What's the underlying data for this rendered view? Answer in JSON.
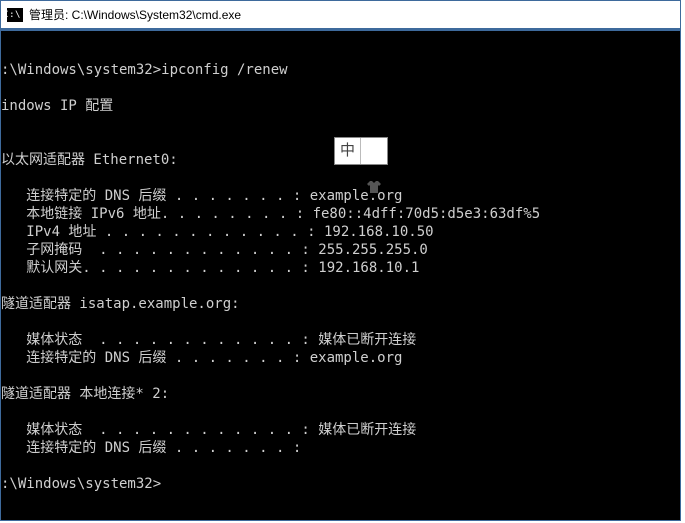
{
  "window": {
    "icon_text": "C:\\.",
    "title": "管理员: C:\\Windows\\System32\\cmd.exe"
  },
  "ime": {
    "mode": "中",
    "icon": "tshirt-icon"
  },
  "terminal": {
    "line01": ":\\Windows\\system32>ipconfig /renew",
    "line02": "",
    "line03": "indows IP 配置",
    "line04": "",
    "line05": "",
    "line06": "以太网适配器 Ethernet0:",
    "line07": "",
    "line08": "   连接特定的 DNS 后缀 . . . . . . . : example.org",
    "line09": "   本地链接 IPv6 地址. . . . . . . . : fe80::4dff:70d5:d5e3:63df%5",
    "line10": "   IPv4 地址 . . . . . . . . . . . . : 192.168.10.50",
    "line11": "   子网掩码  . . . . . . . . . . . . : 255.255.255.0",
    "line12": "   默认网关. . . . . . . . . . . . . : 192.168.10.1",
    "line13": "",
    "line14": "隧道适配器 isatap.example.org:",
    "line15": "",
    "line16": "   媒体状态  . . . . . . . . . . . . : 媒体已断开连接",
    "line17": "   连接特定的 DNS 后缀 . . . . . . . : example.org",
    "line18": "",
    "line19": "隧道适配器 本地连接* 2:",
    "line20": "",
    "line21": "   媒体状态  . . . . . . . . . . . . : 媒体已断开连接",
    "line22": "   连接特定的 DNS 后缀 . . . . . . . :",
    "line23": "",
    "line24": ":\\Windows\\system32>"
  }
}
